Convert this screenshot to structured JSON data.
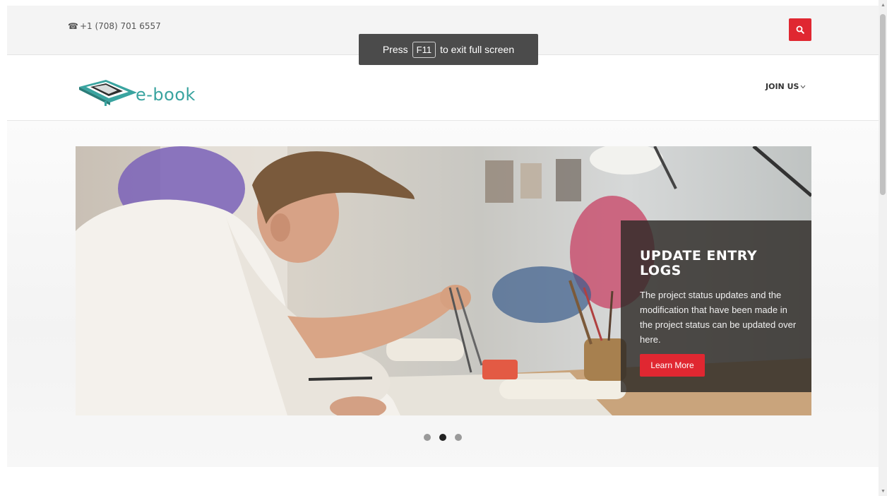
{
  "topbar": {
    "phone": "+1 (708) 701 6557",
    "phone_icon": "phone-icon",
    "search_icon": "search-icon"
  },
  "fullscreen_toast": {
    "prefix": "Press",
    "key": "F11",
    "suffix": "to exit full screen"
  },
  "navbar": {
    "logo_text": "e-book",
    "menu": [
      {
        "label": "JOIN US",
        "icon": "chevron-down-icon"
      }
    ]
  },
  "slider": {
    "title": "UPDATE ENTRY LOGS",
    "text": "The project status updates and the modification that have been made in the project status can be updated over here.",
    "button": "Learn More",
    "dots": {
      "count": 3,
      "active_index": 1
    }
  },
  "colors": {
    "accent": "#e02731",
    "logo": "#3aa4a0",
    "topbar_bg": "#f4f4f4"
  }
}
